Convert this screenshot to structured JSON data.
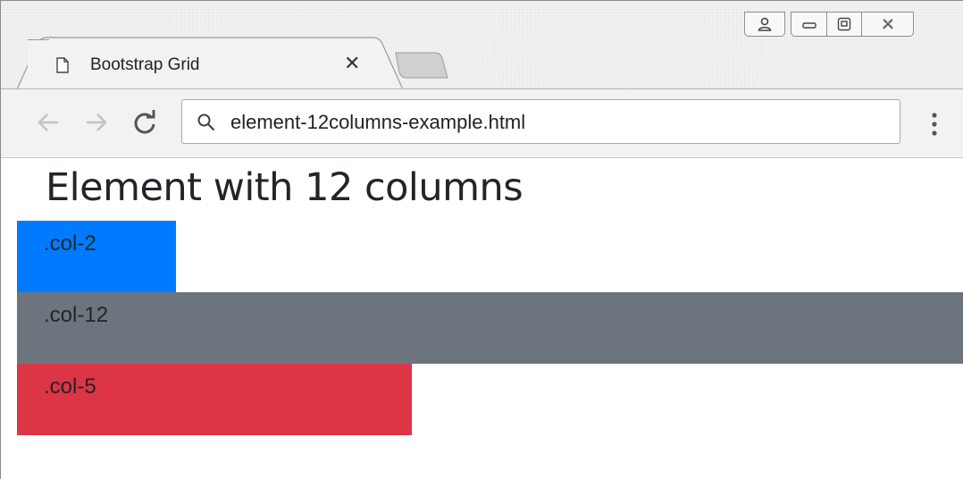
{
  "browser": {
    "tab": {
      "title": "Bootstrap Grid",
      "close_label": "✕",
      "icon": "document-icon"
    },
    "new_tab_icon": "new-tab-icon",
    "caption_buttons": [
      "user-icon",
      "minimize-icon",
      "maximize-icon",
      "close-icon"
    ],
    "toolbar": {
      "back_icon": "back-arrow-icon",
      "forward_icon": "forward-arrow-icon",
      "reload_icon": "reload-icon",
      "search_icon": "search-icon",
      "address": "element-12columns-example.html",
      "menu_icon": "kebab-menu-icon"
    }
  },
  "page": {
    "heading": "Element with 12 columns",
    "columns": [
      {
        "label": ".col-2",
        "color": "#007bff",
        "span": 2
      },
      {
        "label": ".col-12",
        "color": "#6c757d",
        "span": 12
      },
      {
        "label": ".col-5",
        "color": "#dc3545",
        "span": 5
      }
    ]
  }
}
